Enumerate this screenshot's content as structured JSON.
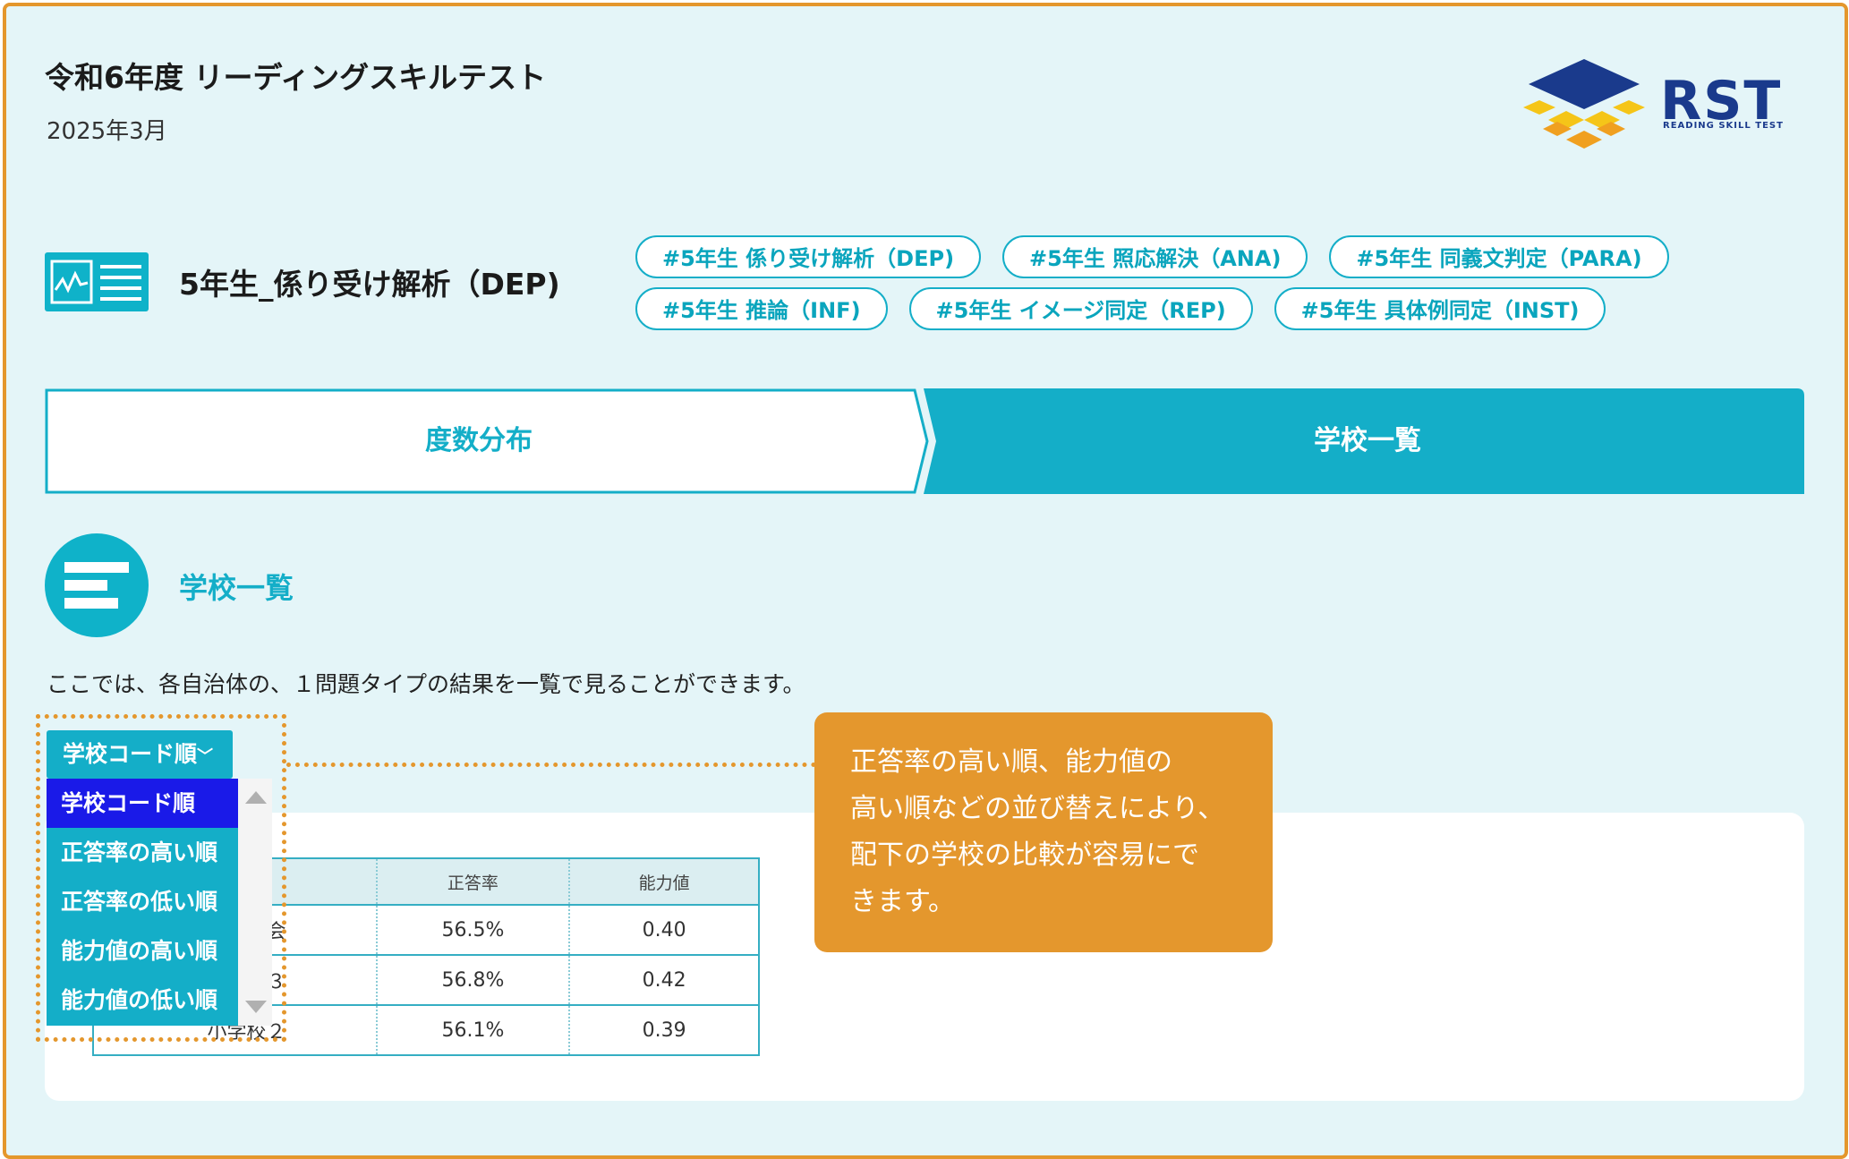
{
  "header": {
    "title": "令和6年度 リーディングスキルテスト",
    "date": "2025年3月"
  },
  "logo": {
    "text": "RST",
    "subtext": "READING SKILL TEST",
    "colors": {
      "navy": "#1a3a8c",
      "yellow": "#f5c518",
      "orange": "#f0a020"
    }
  },
  "section": {
    "icon": "chart-document-icon",
    "title": "5年生_係り受け解析（DEP)"
  },
  "tags": [
    "#5年生 係り受け解析（DEP)",
    "#5年生 照応解決（ANA)",
    "#5年生 同義文判定（PARA)",
    "#5年生 推論（INF)",
    "#5年生 イメージ同定（REP)",
    "#5年生 具体例同定（INST)"
  ],
  "tabs": {
    "frequency": "度数分布",
    "school_list": "学校一覧",
    "active": "学校一覧"
  },
  "list": {
    "icon": "list-icon",
    "title": "学校一覧",
    "description": "ここでは、各自治体の、１問題タイプの結果を一覧で見ることができます。"
  },
  "sort": {
    "selected": "学校コード順",
    "options": [
      "学校コード順",
      "正答率の高い順",
      "正答率の低い順",
      "能力値の高い順",
      "能力値の低い順"
    ]
  },
  "table": {
    "headers": [
      "",
      "正答率",
      "能力値"
    ],
    "rows": [
      {
        "name": "員会",
        "rate": "56.5%",
        "score": "0.40"
      },
      {
        "name": "小学校３",
        "rate": "56.8%",
        "score": "0.42"
      },
      {
        "name": "小学校２",
        "rate": "56.1%",
        "score": "0.39"
      }
    ]
  },
  "callout": {
    "lines": [
      "正答率の高い順、能力値の",
      "高い順などの並び替えにより、",
      "配下の学校の比較が容易にで",
      "きます。"
    ]
  },
  "colors": {
    "accent": "#14aec8",
    "frame": "#e4972d",
    "background": "#e4f5f8",
    "selected": "#1a1ae8"
  }
}
